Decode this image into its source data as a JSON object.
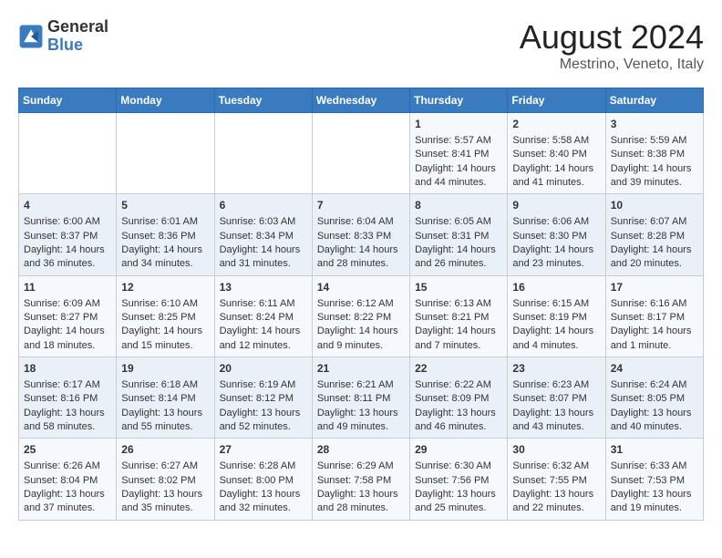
{
  "logo": {
    "line1": "General",
    "line2": "Blue"
  },
  "title": "August 2024",
  "subtitle": "Mestrino, Veneto, Italy",
  "weekdays": [
    "Sunday",
    "Monday",
    "Tuesday",
    "Wednesday",
    "Thursday",
    "Friday",
    "Saturday"
  ],
  "weeks": [
    [
      {
        "day": "",
        "sunrise": "",
        "sunset": "",
        "daylight": ""
      },
      {
        "day": "",
        "sunrise": "",
        "sunset": "",
        "daylight": ""
      },
      {
        "day": "",
        "sunrise": "",
        "sunset": "",
        "daylight": ""
      },
      {
        "day": "",
        "sunrise": "",
        "sunset": "",
        "daylight": ""
      },
      {
        "day": "1",
        "sunrise": "Sunrise: 5:57 AM",
        "sunset": "Sunset: 8:41 PM",
        "daylight": "Daylight: 14 hours and 44 minutes."
      },
      {
        "day": "2",
        "sunrise": "Sunrise: 5:58 AM",
        "sunset": "Sunset: 8:40 PM",
        "daylight": "Daylight: 14 hours and 41 minutes."
      },
      {
        "day": "3",
        "sunrise": "Sunrise: 5:59 AM",
        "sunset": "Sunset: 8:38 PM",
        "daylight": "Daylight: 14 hours and 39 minutes."
      }
    ],
    [
      {
        "day": "4",
        "sunrise": "Sunrise: 6:00 AM",
        "sunset": "Sunset: 8:37 PM",
        "daylight": "Daylight: 14 hours and 36 minutes."
      },
      {
        "day": "5",
        "sunrise": "Sunrise: 6:01 AM",
        "sunset": "Sunset: 8:36 PM",
        "daylight": "Daylight: 14 hours and 34 minutes."
      },
      {
        "day": "6",
        "sunrise": "Sunrise: 6:03 AM",
        "sunset": "Sunset: 8:34 PM",
        "daylight": "Daylight: 14 hours and 31 minutes."
      },
      {
        "day": "7",
        "sunrise": "Sunrise: 6:04 AM",
        "sunset": "Sunset: 8:33 PM",
        "daylight": "Daylight: 14 hours and 28 minutes."
      },
      {
        "day": "8",
        "sunrise": "Sunrise: 6:05 AM",
        "sunset": "Sunset: 8:31 PM",
        "daylight": "Daylight: 14 hours and 26 minutes."
      },
      {
        "day": "9",
        "sunrise": "Sunrise: 6:06 AM",
        "sunset": "Sunset: 8:30 PM",
        "daylight": "Daylight: 14 hours and 23 minutes."
      },
      {
        "day": "10",
        "sunrise": "Sunrise: 6:07 AM",
        "sunset": "Sunset: 8:28 PM",
        "daylight": "Daylight: 14 hours and 20 minutes."
      }
    ],
    [
      {
        "day": "11",
        "sunrise": "Sunrise: 6:09 AM",
        "sunset": "Sunset: 8:27 PM",
        "daylight": "Daylight: 14 hours and 18 minutes."
      },
      {
        "day": "12",
        "sunrise": "Sunrise: 6:10 AM",
        "sunset": "Sunset: 8:25 PM",
        "daylight": "Daylight: 14 hours and 15 minutes."
      },
      {
        "day": "13",
        "sunrise": "Sunrise: 6:11 AM",
        "sunset": "Sunset: 8:24 PM",
        "daylight": "Daylight: 14 hours and 12 minutes."
      },
      {
        "day": "14",
        "sunrise": "Sunrise: 6:12 AM",
        "sunset": "Sunset: 8:22 PM",
        "daylight": "Daylight: 14 hours and 9 minutes."
      },
      {
        "day": "15",
        "sunrise": "Sunrise: 6:13 AM",
        "sunset": "Sunset: 8:21 PM",
        "daylight": "Daylight: 14 hours and 7 minutes."
      },
      {
        "day": "16",
        "sunrise": "Sunrise: 6:15 AM",
        "sunset": "Sunset: 8:19 PM",
        "daylight": "Daylight: 14 hours and 4 minutes."
      },
      {
        "day": "17",
        "sunrise": "Sunrise: 6:16 AM",
        "sunset": "Sunset: 8:17 PM",
        "daylight": "Daylight: 14 hours and 1 minute."
      }
    ],
    [
      {
        "day": "18",
        "sunrise": "Sunrise: 6:17 AM",
        "sunset": "Sunset: 8:16 PM",
        "daylight": "Daylight: 13 hours and 58 minutes."
      },
      {
        "day": "19",
        "sunrise": "Sunrise: 6:18 AM",
        "sunset": "Sunset: 8:14 PM",
        "daylight": "Daylight: 13 hours and 55 minutes."
      },
      {
        "day": "20",
        "sunrise": "Sunrise: 6:19 AM",
        "sunset": "Sunset: 8:12 PM",
        "daylight": "Daylight: 13 hours and 52 minutes."
      },
      {
        "day": "21",
        "sunrise": "Sunrise: 6:21 AM",
        "sunset": "Sunset: 8:11 PM",
        "daylight": "Daylight: 13 hours and 49 minutes."
      },
      {
        "day": "22",
        "sunrise": "Sunrise: 6:22 AM",
        "sunset": "Sunset: 8:09 PM",
        "daylight": "Daylight: 13 hours and 46 minutes."
      },
      {
        "day": "23",
        "sunrise": "Sunrise: 6:23 AM",
        "sunset": "Sunset: 8:07 PM",
        "daylight": "Daylight: 13 hours and 43 minutes."
      },
      {
        "day": "24",
        "sunrise": "Sunrise: 6:24 AM",
        "sunset": "Sunset: 8:05 PM",
        "daylight": "Daylight: 13 hours and 40 minutes."
      }
    ],
    [
      {
        "day": "25",
        "sunrise": "Sunrise: 6:26 AM",
        "sunset": "Sunset: 8:04 PM",
        "daylight": "Daylight: 13 hours and 37 minutes."
      },
      {
        "day": "26",
        "sunrise": "Sunrise: 6:27 AM",
        "sunset": "Sunset: 8:02 PM",
        "daylight": "Daylight: 13 hours and 35 minutes."
      },
      {
        "day": "27",
        "sunrise": "Sunrise: 6:28 AM",
        "sunset": "Sunset: 8:00 PM",
        "daylight": "Daylight: 13 hours and 32 minutes."
      },
      {
        "day": "28",
        "sunrise": "Sunrise: 6:29 AM",
        "sunset": "Sunset: 7:58 PM",
        "daylight": "Daylight: 13 hours and 28 minutes."
      },
      {
        "day": "29",
        "sunrise": "Sunrise: 6:30 AM",
        "sunset": "Sunset: 7:56 PM",
        "daylight": "Daylight: 13 hours and 25 minutes."
      },
      {
        "day": "30",
        "sunrise": "Sunrise: 6:32 AM",
        "sunset": "Sunset: 7:55 PM",
        "daylight": "Daylight: 13 hours and 22 minutes."
      },
      {
        "day": "31",
        "sunrise": "Sunrise: 6:33 AM",
        "sunset": "Sunset: 7:53 PM",
        "daylight": "Daylight: 13 hours and 19 minutes."
      }
    ]
  ]
}
